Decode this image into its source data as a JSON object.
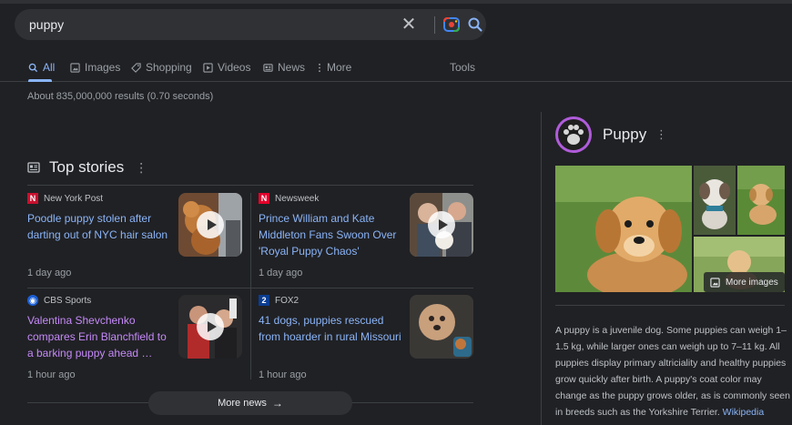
{
  "search": {
    "query": "puppy"
  },
  "tabs": [
    {
      "label": "All",
      "active": true
    },
    {
      "label": "Images"
    },
    {
      "label": "Shopping"
    },
    {
      "label": "Videos"
    },
    {
      "label": "News"
    },
    {
      "label": "More"
    },
    {
      "label": "Tools"
    }
  ],
  "result_stats": "About 835,000,000 results (0.70 seconds)",
  "top_stories": {
    "title": "Top stories",
    "more_news_label": "More news",
    "stories": [
      {
        "source": "New York Post",
        "headline": "Poodle puppy stolen after darting out of NYC hair salon",
        "age": "1 day ago",
        "has_video": true
      },
      {
        "source": "Newsweek",
        "headline": "Prince William and Kate Middleton Fans Swoon Over 'Royal Puppy Chaos'",
        "age": "1 day ago",
        "has_video": true
      },
      {
        "source": "CBS Sports",
        "headline": "Valentina Shevchenko compares Erin Blanchfield to a barking puppy ahead …",
        "age": "1 hour ago",
        "has_video": true
      },
      {
        "source": "FOX2",
        "headline": "41 dogs, puppies rescued from hoarder in rural Missouri",
        "age": "1 hour ago",
        "has_video": false
      }
    ]
  },
  "knowledge_panel": {
    "title": "Puppy",
    "more_images_label": "More images",
    "description": "A puppy is a juvenile dog. Some puppies can weigh 1–1.5 kg, while larger ones can weigh up to 7–11 kg. All puppies display primary altriciality and healthy puppies grow quickly after birth. A puppy's coat color may change as the puppy grows older, as is commonly seen in breeds such as the Yorkshire Terrier.",
    "source_link": "Wikipedia"
  },
  "colors": {
    "background": "#202124",
    "surface": "#303134",
    "link": "#8ab4f8",
    "visited_link": "#c58af9",
    "text": "#bdc1c6",
    "muted_text": "#9aa0a6",
    "divider": "#3c4043",
    "kp_icon_purple": "#b05cdb"
  }
}
